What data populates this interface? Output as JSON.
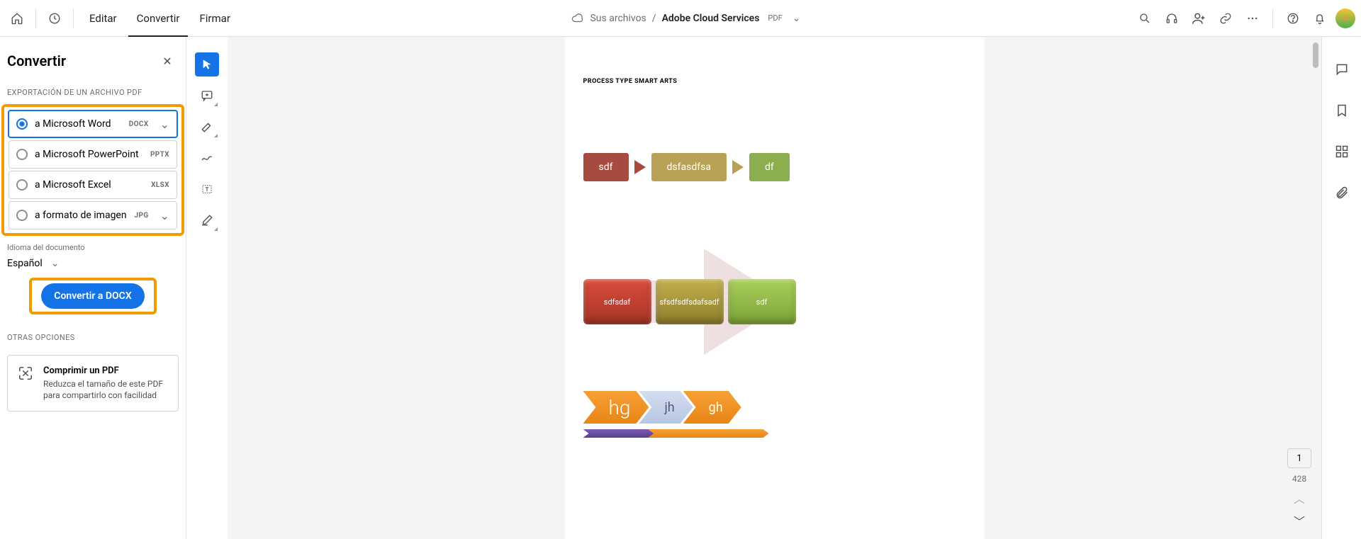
{
  "header": {
    "tabs": {
      "edit": "Editar",
      "convert": "Convertir",
      "sign": "Firmar"
    },
    "breadcrumb": {
      "yourFiles": "Sus archivos",
      "fileName": "Adobe Cloud Services",
      "fileType": "PDF"
    }
  },
  "panel": {
    "title": "Convertir",
    "exportSection": "EXPORTACIÓN DE UN ARCHIVO PDF",
    "options": {
      "word": {
        "label": "a Microsoft Word",
        "ext": "DOCX"
      },
      "ppt": {
        "label": "a Microsoft PowerPoint",
        "ext": "PPTX"
      },
      "excel": {
        "label": "a Microsoft Excel",
        "ext": "XLSX"
      },
      "image": {
        "label": "a formato de imagen",
        "ext": "JPG"
      }
    },
    "langLabel": "Idioma del documento",
    "language": "Español",
    "cta": "Convertir a DOCX",
    "otherSection": "OTRAS OPCIONES",
    "compress": {
      "title": "Comprimir un PDF",
      "desc": "Reduzca el tamaño de este PDF para compartirlo con facilidad"
    }
  },
  "document": {
    "heading": "PROCESS TYPE SMART ARTS",
    "row1": [
      "sdf",
      "dsfasdfsa",
      "df"
    ],
    "row2": [
      "sdfsdaf",
      "sfsdfsdfsdafsadf",
      "sdf"
    ],
    "row3": [
      "hg",
      "jh",
      "gh"
    ]
  },
  "pagination": {
    "current": "1",
    "total": "428"
  }
}
